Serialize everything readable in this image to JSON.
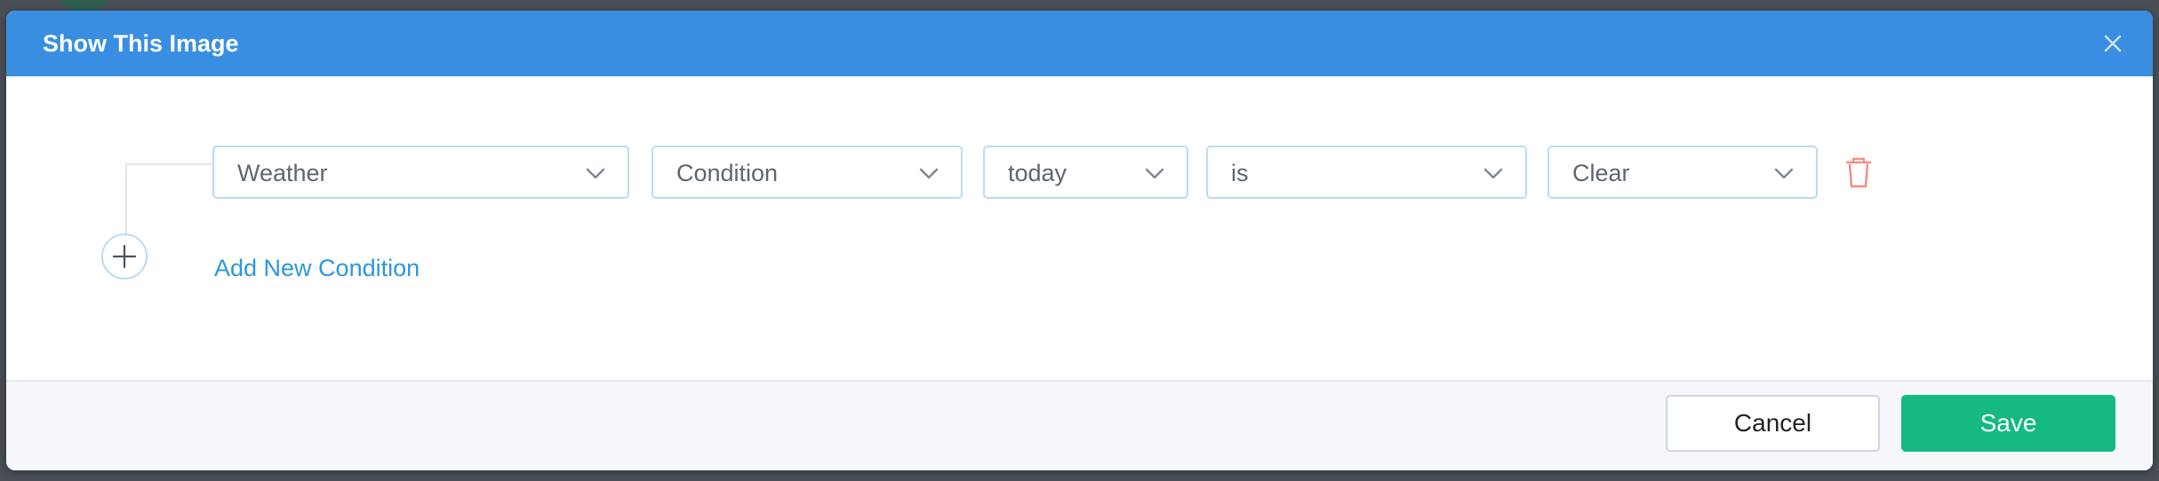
{
  "dialog": {
    "title": "Show This Image",
    "close_icon": "close-icon"
  },
  "condition": {
    "field": "Weather",
    "property": "Condition",
    "timeframe": "today",
    "operator": "is",
    "value": "Clear",
    "delete_icon": "trash-icon",
    "chevron_icon": "chevron-down-icon"
  },
  "add_condition": {
    "icon": "plus-icon",
    "label": "Add New Condition"
  },
  "footer": {
    "cancel_label": "Cancel",
    "save_label": "Save"
  },
  "colors": {
    "header": "#3a8ee2",
    "save": "#15b982",
    "link": "#2b97e0",
    "delete": "#f28b82",
    "select_border": "#b9dcf2"
  }
}
